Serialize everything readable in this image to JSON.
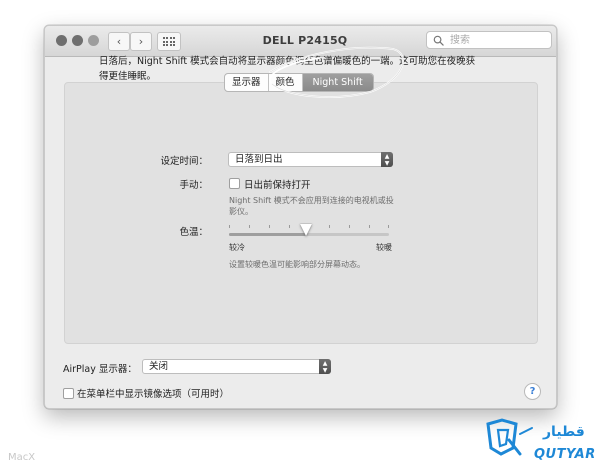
{
  "window": {
    "title": "DELL P2415Q",
    "search_placeholder": "搜索"
  },
  "tabs": [
    {
      "label": "显示器",
      "selected": false
    },
    {
      "label": "颜色",
      "selected": false
    },
    {
      "label": "Night Shift",
      "selected": true
    }
  ],
  "night_shift": {
    "description": "日落后，Night Shift 模式会自动将显示器颜色调至色谱偏暖色的一端。这可助您在夜晚获得更佳睡眠。",
    "schedule_label": "设定时间：",
    "schedule_value": "日落到日出",
    "manual_label": "手动：",
    "manual_checkbox_label": "日出前保持打开",
    "manual_checked": false,
    "manual_hint": "Night Shift 模式不会应用到连接的电视机或投影仪。",
    "temperature_label": "色温：",
    "temperature_min_label": "较冷",
    "temperature_max_label": "较暖",
    "temperature_level": 0.48,
    "temperature_hint": "设置较暖色温可能影响部分屏幕动态。"
  },
  "airplay": {
    "label": "AirPlay 显示器：",
    "value": "关闭"
  },
  "mirror_option": {
    "label": "在菜单栏中显示镜像选项（可用时）",
    "checked": false
  },
  "help_label": "?",
  "watermarks": {
    "macx": "MacX",
    "qutyar": "QUTYAR",
    "qutyar_arabic": "قطیار"
  },
  "colors": {
    "tab_selected": "#8f8f8f",
    "logo_blue": "#1e88d6"
  }
}
